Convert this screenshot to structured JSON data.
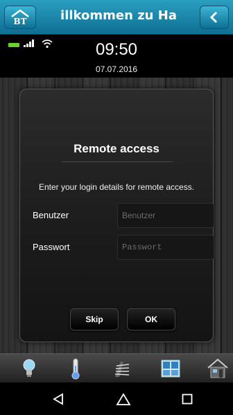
{
  "header": {
    "title": "illkommen zu Ha",
    "logo_icon": "home-logo-icon",
    "back_icon": "chevron-left-icon"
  },
  "status_bar": {
    "time": "09:50",
    "date": "07.07.2016",
    "icons": [
      "battery-icon",
      "signal-icon",
      "wifi-icon"
    ]
  },
  "dialog": {
    "title": "Remote access",
    "message": "Enter your login details for remote access.",
    "user_label": "Benutzer",
    "user_placeholder": "Benutzer",
    "user_value": "",
    "password_label": "Passwort",
    "password_placeholder": "Passwort",
    "password_value": "",
    "skip_label": "Skip",
    "ok_label": "OK"
  },
  "tabs": [
    "lightbulb-icon",
    "thermometer-icon",
    "blinds-icon",
    "window-icon",
    "house-icon"
  ],
  "navigation": [
    "back-triangle-icon",
    "home-circle-icon",
    "recents-square-icon"
  ],
  "colors": {
    "accent": "#1a8ab0",
    "background": "#000000",
    "dialog": "#1f1f1f"
  }
}
